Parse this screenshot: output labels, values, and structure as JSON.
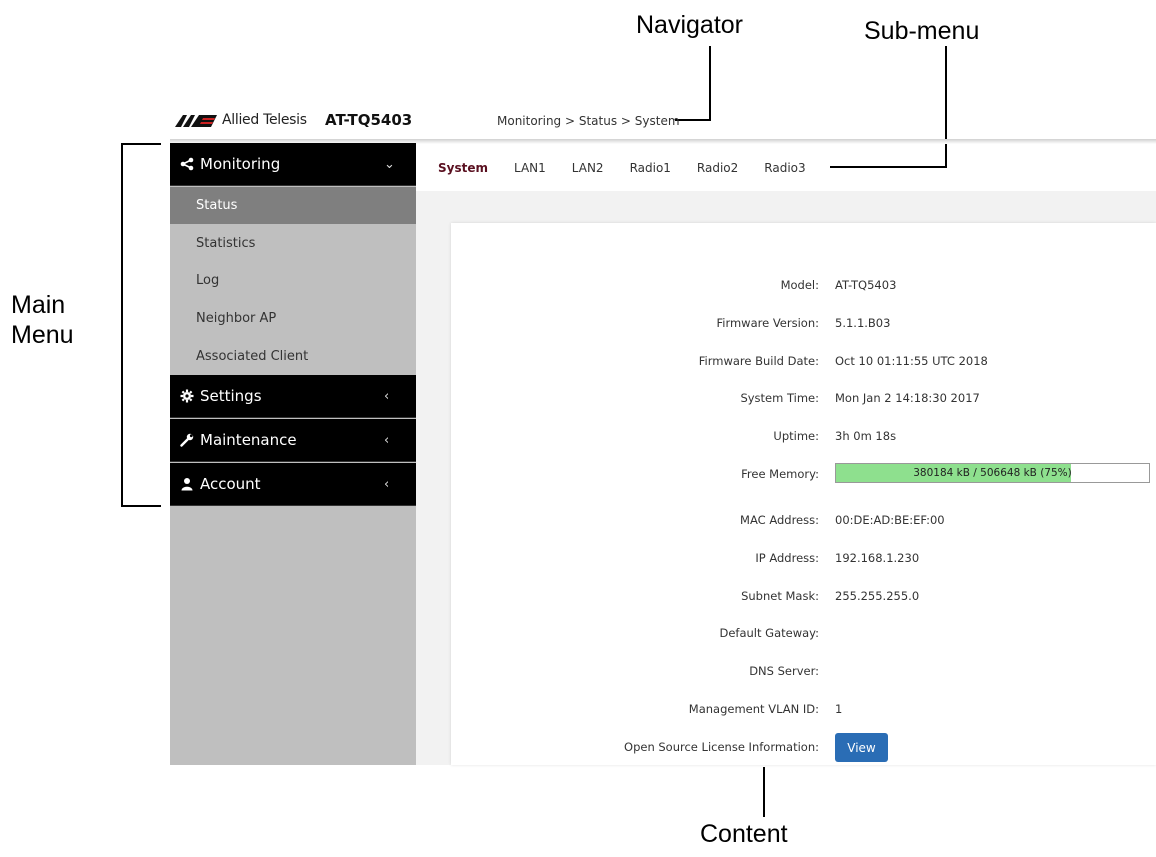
{
  "callouts": {
    "navigator": "Navigator",
    "sub_menu": "Sub-menu",
    "main_menu_line1": "Main",
    "main_menu_line2": "Menu",
    "content": "Content"
  },
  "header": {
    "brand": "Allied Telesis",
    "model": "AT-TQ5403",
    "breadcrumb": "Monitoring > Status > System"
  },
  "sidebar": {
    "monitoring": {
      "label": "Monitoring",
      "icon": "share-icon",
      "chevron": "⌄"
    },
    "items": [
      {
        "label": "Status",
        "active": true
      },
      {
        "label": "Statistics"
      },
      {
        "label": "Log"
      },
      {
        "label": "Neighbor AP"
      },
      {
        "label": "Associated Client"
      }
    ],
    "settings": {
      "label": "Settings",
      "icon": "gear-icon",
      "chevron": "‹"
    },
    "maintenance": {
      "label": "Maintenance",
      "icon": "wrench-icon",
      "chevron": "‹"
    },
    "account": {
      "label": "Account",
      "icon": "user-icon",
      "chevron": "‹"
    }
  },
  "tabs": [
    "System",
    "LAN1",
    "LAN2",
    "Radio1",
    "Radio2",
    "Radio3"
  ],
  "system_info": {
    "model": {
      "label": "Model:",
      "value": "AT-TQ5403"
    },
    "firmware_version": {
      "label": "Firmware Version:",
      "value": "5.1.1.B03"
    },
    "firmware_build_date": {
      "label": "Firmware Build Date:",
      "value": "Oct 10 01:11:55 UTC 2018"
    },
    "system_time": {
      "label": "System Time:",
      "value": "Mon Jan 2 14:18:30 2017"
    },
    "uptime": {
      "label": "Uptime:",
      "value": "3h 0m 18s"
    },
    "free_memory": {
      "label": "Free Memory:",
      "value": "380184 kB / 506648 kB (75%)",
      "fraction": 0.75
    },
    "mac_address": {
      "label": "MAC Address:",
      "value": "00:DE:AD:BE:EF:00"
    },
    "ip_address": {
      "label": "IP Address:",
      "value": "192.168.1.230"
    },
    "subnet_mask": {
      "label": "Subnet Mask:",
      "value": "255.255.255.0"
    },
    "default_gateway": {
      "label": "Default Gateway:",
      "value": ""
    },
    "dns_server": {
      "label": "DNS Server:",
      "value": ""
    },
    "management_vlan": {
      "label": "Management VLAN ID:",
      "value": "1"
    },
    "license": {
      "label": "Open Source License Information:",
      "button": "View"
    }
  },
  "colors": {
    "accent_blue": "#2a6db5",
    "memory_fill": "#8ee08e",
    "active_tab": "#5a1020"
  }
}
